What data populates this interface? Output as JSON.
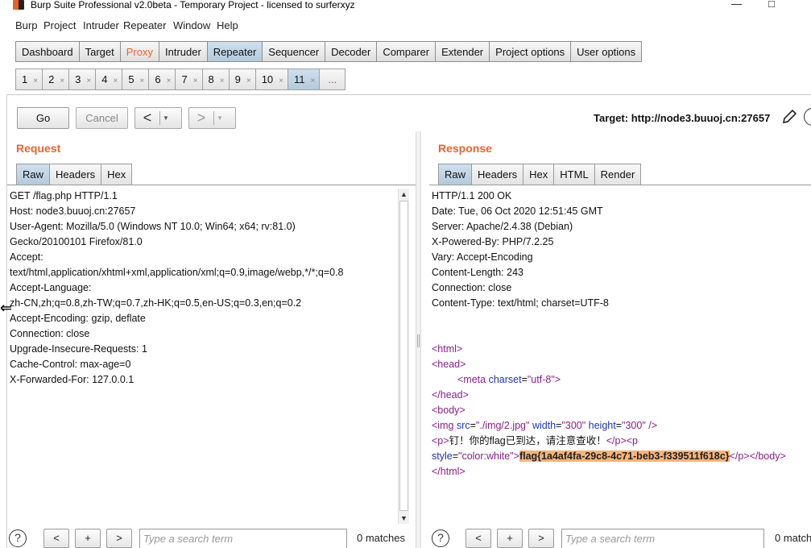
{
  "window": {
    "title": "Burp Suite Professional v2.0beta - Temporary Project - licensed to surferxyz",
    "controls": {
      "minimize": "—",
      "maximize": "□"
    }
  },
  "menu": [
    "Burp",
    "Project",
    "Intruder",
    "Repeater",
    "Window",
    "Help"
  ],
  "main_tabs": [
    "Dashboard",
    "Target",
    "Proxy",
    "Intruder",
    "Repeater",
    "Sequencer",
    "Decoder",
    "Comparer",
    "Extender",
    "Project options",
    "User options"
  ],
  "active_main_tab": "Repeater",
  "repeater_tabs": [
    "1",
    "2",
    "3",
    "4",
    "5",
    "6",
    "7",
    "8",
    "9",
    "10",
    "11"
  ],
  "repeater_tab_close": "×",
  "repeater_tab_more": "...",
  "active_repeater_tab": "11",
  "toolbar": {
    "go": "Go",
    "cancel": "Cancel",
    "back_arrow": "<",
    "forward_arrow": ">",
    "dropdown": "▼",
    "target": "Target: http://node3.buuoj.cn:27657"
  },
  "request": {
    "title": "Request",
    "tabs": [
      "Raw",
      "Headers",
      "Hex"
    ],
    "active_tab": "Raw",
    "lines": [
      "GET /flag.php HTTP/1.1",
      "Host: node3.buuoj.cn:27657",
      "User-Agent: Mozilla/5.0 (Windows NT 10.0; Win64; x64; rv:81.0)",
      "Gecko/20100101 Firefox/81.0",
      "Accept:",
      "text/html,application/xhtml+xml,application/xml;q=0.9,image/webp,*/*;q=0.8",
      "Accept-Language:",
      "zh-CN,zh;q=0.8,zh-TW;q=0.7,zh-HK;q=0.5,en-US;q=0.3,en;q=0.2",
      "Accept-Encoding: gzip, deflate",
      "Connection: close",
      "Upgrade-Insecure-Requests: 1",
      "Cache-Control: max-age=0",
      "X-Forwarded-For: 127.0.0.1"
    ]
  },
  "response": {
    "title": "Response",
    "tabs": [
      "Raw",
      "Headers",
      "Hex",
      "HTML",
      "Render"
    ],
    "active_tab": "Raw",
    "headers": [
      "HTTP/1.1 200 OK",
      "Date: Tue, 06 Oct 2020 12:51:45 GMT",
      "Server: Apache/2.4.38 (Debian)",
      "X-Powered-By: PHP/7.2.25",
      "Vary: Accept-Encoding",
      "Content-Length: 243",
      "Connection: close",
      "Content-Type: text/html; charset=UTF-8"
    ],
    "body": {
      "html_open": "<html>",
      "head_open": "<head>",
      "meta_open": "<meta ",
      "meta_attr": "charset",
      "meta_eq": "=",
      "meta_val": "\"utf-8\"",
      "meta_close": ">",
      "head_close": "</head>",
      "body_open": "<body>",
      "img_open": "<img ",
      "img_src_attr": "src",
      "img_src_val": "\"./img/2.jpg\"",
      "img_width_attr": "width",
      "img_width_val": "\"300\"",
      "img_height_attr": "height",
      "img_height_val": "\"300\"",
      "img_close": " />",
      "p_open": "<p>",
      "p_text": "钉！你的flag已到达，请注意查收！",
      "p_close_p_open": "</p><p",
      "style_attr": "style",
      "style_val": "\"color:white\"",
      "gt": ">",
      "flag": "flag{1a4af4fa-29c8-4c71-beb3-f339511f618c}",
      "tail": "</p></body>",
      "html_close": "</html>"
    }
  },
  "footer": {
    "help": "?",
    "prev": "<",
    "add": "+",
    "next": ">",
    "search_placeholder": "Type a search term",
    "request_matches": "0 matches",
    "response_matches": "0 match"
  },
  "colors": {
    "accent_orange": "#e8662e",
    "active_tab": "#b3cadb",
    "highlight": "#f5b47c"
  },
  "scrollbar": {
    "up_arrow": "▲",
    "down_arrow": "▼"
  },
  "splitter_marker": "⇐"
}
